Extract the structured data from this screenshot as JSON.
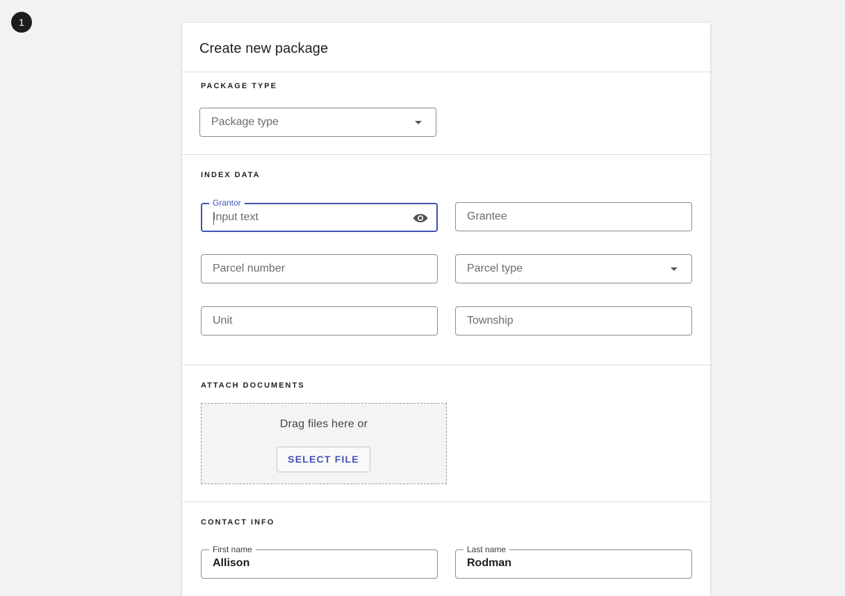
{
  "step_badge": "1",
  "card": {
    "title": "Create new package"
  },
  "package_type": {
    "heading": "Package type",
    "select_placeholder": "Package type"
  },
  "index_data": {
    "heading": "Index data",
    "grantor": {
      "label": "Grantor",
      "placeholder": "Input text"
    },
    "grantee": {
      "placeholder": "Grantee"
    },
    "parcel_number": {
      "placeholder": "Parcel number"
    },
    "parcel_type": {
      "placeholder": "Parcel type"
    },
    "unit": {
      "placeholder": "Unit"
    },
    "township": {
      "placeholder": "Township"
    }
  },
  "attach_documents": {
    "heading": "Attach documents",
    "drop_text": "Drag files here or",
    "select_button": "SELECT FILE"
  },
  "contact_info": {
    "heading": "Contact info",
    "first_name": {
      "label": "First name",
      "value": "Allison"
    },
    "last_name": {
      "label": "Last name",
      "value": "Rodman"
    }
  },
  "colors": {
    "accent": "#3f51b5",
    "background": "#f2f2f2",
    "border": "#8a8a8a"
  },
  "icons": {
    "visibility": "eye-icon",
    "dropdown": "chevron-down-icon"
  }
}
